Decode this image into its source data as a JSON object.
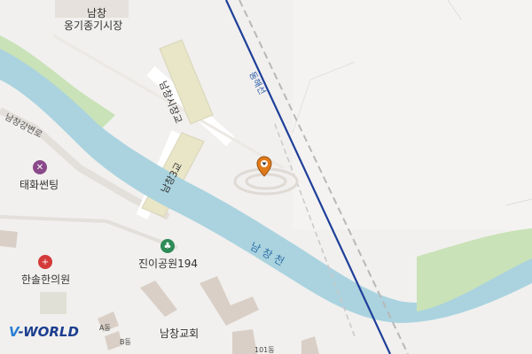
{
  "labels": {
    "market_top": "남창",
    "market_bottom": "옹기종기시장",
    "bridge_sijang": "남창시장교",
    "bridge_3": "남창3교",
    "riverside_road": "남창강변로",
    "rail_line": "동해선",
    "center": "태화썬팅",
    "park": "진이공원194",
    "clinic": "한솔한의원",
    "river": "남창천",
    "church": "남창교회",
    "bldg_a": "A동",
    "bldg_b": "B동",
    "bldg_101": "101동"
  },
  "logo": {
    "prefix": "V",
    "text": "-WORLD"
  },
  "icons": {
    "center": "tools-icon",
    "park": "park-icon",
    "clinic": "hospital-icon",
    "marker": "location-marker-icon"
  },
  "colors": {
    "water": "#aad3df",
    "rail": "#1f3f9a",
    "green": "#c9e2b7",
    "building": "#d9cfc6"
  }
}
